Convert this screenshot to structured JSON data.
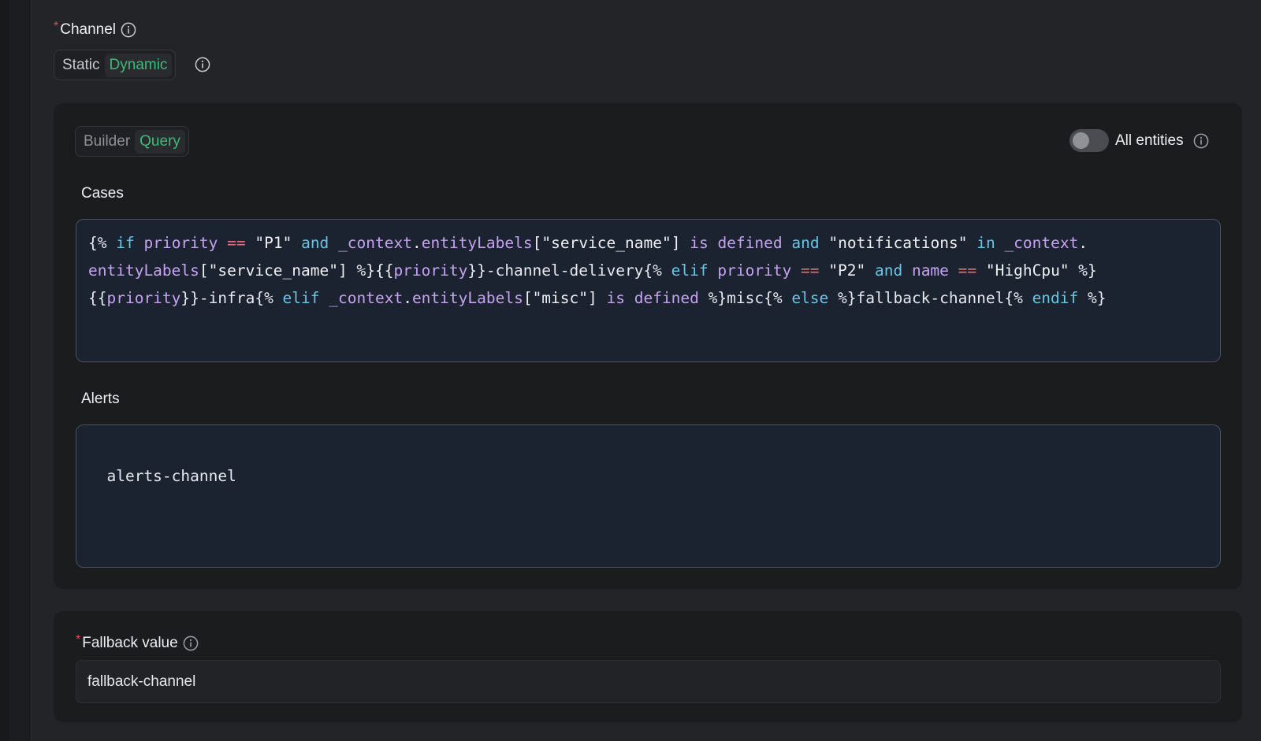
{
  "channel": {
    "label": "Channel",
    "required_mark": "*",
    "modes": [
      {
        "label": "Static",
        "active": false
      },
      {
        "label": "Dynamic",
        "active": true
      }
    ]
  },
  "query_panel": {
    "modes": [
      {
        "label": "Builder",
        "active": false
      },
      {
        "label": "Query",
        "active": true
      }
    ],
    "all_entities": {
      "label": "All entities",
      "enabled": false
    },
    "cases": {
      "title": "Cases",
      "lines": [
        [
          {
            "t": "{% ",
            "c": "plain"
          },
          {
            "t": "if",
            "c": "kw"
          },
          {
            "t": " ",
            "c": "plain"
          },
          {
            "t": "priority",
            "c": "var"
          },
          {
            "t": " ",
            "c": "plain"
          },
          {
            "t": "==",
            "c": "op"
          },
          {
            "t": " \"P1\" ",
            "c": "str"
          },
          {
            "t": "and",
            "c": "kw"
          },
          {
            "t": " ",
            "c": "plain"
          },
          {
            "t": "_context",
            "c": "var"
          },
          {
            "t": ".",
            "c": "plain"
          },
          {
            "t": "entityLabels",
            "c": "var"
          },
          {
            "t": "[\"service_name\"] ",
            "c": "str"
          },
          {
            "t": "is defined",
            "c": "var"
          },
          {
            "t": " ",
            "c": "plain"
          },
          {
            "t": "and",
            "c": "kw"
          },
          {
            "t": " \"notifications\" ",
            "c": "str"
          },
          {
            "t": "in",
            "c": "kw"
          },
          {
            "t": " ",
            "c": "plain"
          },
          {
            "t": "_context",
            "c": "var"
          },
          {
            "t": ".",
            "c": "plain"
          }
        ],
        [
          {
            "t": "entityLabels",
            "c": "var"
          },
          {
            "t": "[\"service_name\"] %}{{",
            "c": "str"
          },
          {
            "t": "priority",
            "c": "var"
          },
          {
            "t": "}}-channel-delivery{% ",
            "c": "plain"
          },
          {
            "t": "elif",
            "c": "kw"
          },
          {
            "t": " ",
            "c": "plain"
          },
          {
            "t": "priority",
            "c": "var"
          },
          {
            "t": " ",
            "c": "plain"
          },
          {
            "t": "==",
            "c": "op"
          },
          {
            "t": " \"P2\" ",
            "c": "str"
          },
          {
            "t": "and",
            "c": "kw"
          },
          {
            "t": " ",
            "c": "plain"
          },
          {
            "t": "name",
            "c": "var"
          },
          {
            "t": " ",
            "c": "plain"
          },
          {
            "t": "==",
            "c": "op"
          },
          {
            "t": " \"HighCpu\" %}",
            "c": "str"
          }
        ],
        [
          {
            "t": "{{",
            "c": "plain"
          },
          {
            "t": "priority",
            "c": "var"
          },
          {
            "t": "}}-infra{% ",
            "c": "plain"
          },
          {
            "t": "elif",
            "c": "kw"
          },
          {
            "t": " ",
            "c": "plain"
          },
          {
            "t": "_context",
            "c": "var"
          },
          {
            "t": ".",
            "c": "plain"
          },
          {
            "t": "entityLabels",
            "c": "var"
          },
          {
            "t": "[\"misc\"] ",
            "c": "str"
          },
          {
            "t": "is defined",
            "c": "var"
          },
          {
            "t": " %}misc{% ",
            "c": "plain"
          },
          {
            "t": "else",
            "c": "kw"
          },
          {
            "t": " %}fallback-channel{% ",
            "c": "plain"
          },
          {
            "t": "endif",
            "c": "kw"
          },
          {
            "t": " %}",
            "c": "plain"
          }
        ]
      ]
    },
    "alerts": {
      "title": "Alerts",
      "value": "alerts-channel"
    }
  },
  "fallback": {
    "label": "Fallback value",
    "required_mark": "*",
    "value": "fallback-channel"
  },
  "icons": {
    "info": "info-circle-icon"
  },
  "colors": {
    "accent_green": "#3fb97a",
    "required_red": "#e5484d",
    "keyword": "#67c6e6",
    "variable": "#c6a3f0",
    "operator": "#e4707a"
  }
}
